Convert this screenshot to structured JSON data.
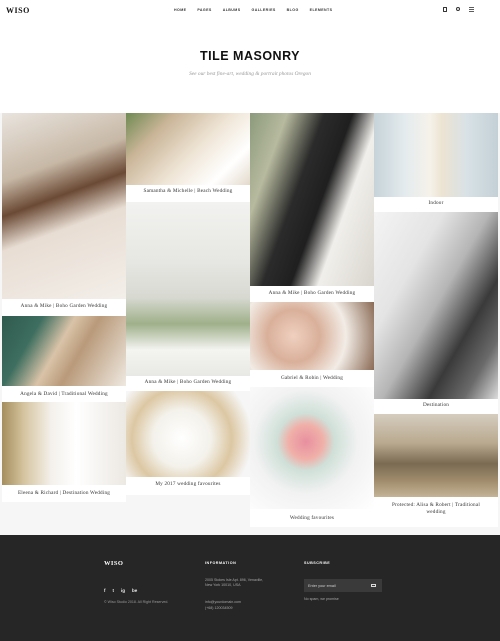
{
  "header": {
    "logo": "WISO",
    "nav": [
      "HOME",
      "PAGES",
      "ALBUMS",
      "GALLERIES",
      "BLOG",
      "ELEMENTS"
    ]
  },
  "hero": {
    "title": "TILE MASONRY",
    "subtitle": "See our best fine-art, wedding & portrait photos Oregon"
  },
  "tiles": [
    {
      "caption": "Anna & Mike | Boho Garden Wedding"
    },
    {
      "caption": "Samantha & Michelle | Beach Wedding"
    },
    {
      "caption": "Anna & Mike | Boho Garden Wedding"
    },
    {
      "caption": "Indoor"
    },
    {
      "caption": "Angela & David | Traditional Wedding"
    },
    {
      "caption": "Anna & Mike | Boho Garden Wedding"
    },
    {
      "caption": "Gabriel & Robin | Wedding"
    },
    {
      "caption": "Destination"
    },
    {
      "caption": "Eleena & Richard | Destination Wedding"
    },
    {
      "caption": "My 2017 wedding favourites"
    },
    {
      "caption": "Wedding favourites"
    },
    {
      "caption": "Protected: Alisa & Robert | Traditional wedding"
    }
  ],
  "footer": {
    "logo": "WISO",
    "social": [
      "f",
      "t",
      "ig",
      "be"
    ],
    "copyright": "© Wiso Studio 2018. All Right Reserved.",
    "info_heading": "INFORMATION",
    "address_line1": "2005 Stokes Isle Apt. 896, Venaville,",
    "address_line2": "New York 10010, USA",
    "email": "info@yourdomain.com",
    "phone": "(+68) 120034509",
    "subscribe_heading": "SUBSCRIBE",
    "email_placeholder": "Enter your email",
    "spam_note": "No spam, we promise"
  }
}
